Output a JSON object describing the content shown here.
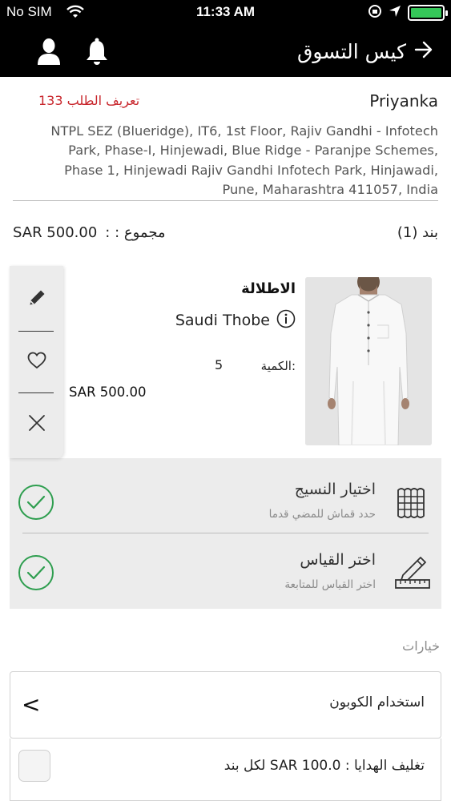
{
  "status_bar": {
    "carrier": "No SIM",
    "time": "11:33 AM",
    "battery_level": 1.0
  },
  "nav": {
    "title": "كيس التسوق",
    "back_icon": "arrow-right-icon",
    "user_icon": "user-icon",
    "bell_icon": "bell-icon"
  },
  "order": {
    "label": "تعريف الطلب 133",
    "customer_name": "Priyanka",
    "address_lines": [
      "NTPL SEZ (Blueridge), IT6, 1st Floor, Rajiv Gandhi - Infotech",
      "Park, Phase-I, Hinjewadi, Blue Ridge - Paranjpe Schemes,",
      "Phase 1, Hinjewadi Rajiv Gandhi Infotech Park, Hinjawadi,",
      "Pune, Maharashtra 411057, India"
    ]
  },
  "summary": {
    "total_label": "مجموع : :",
    "total_value": "SAR 500.00",
    "items_count": "بند (1)"
  },
  "product": {
    "title": "الاطلالة",
    "name": "Saudi Thobe",
    "qty_label": "الكمية:",
    "qty_value": "5",
    "price": "SAR 500.00",
    "actions": [
      "edit-icon",
      "heart-icon",
      "close-icon"
    ]
  },
  "options_rows": [
    {
      "title": "اختيار النسيج",
      "subtitle": "حدد قماش للمضي قدما",
      "icon": "fabric-icon",
      "status": "check-icon"
    },
    {
      "title": "اختر القياس",
      "subtitle": "اختر القياس للمتابعة",
      "icon": "measure-icon",
      "status": "check-icon"
    }
  ],
  "options": {
    "heading": "خيارات",
    "coupon_label": "استخدام الكوبون",
    "coupon_chevron": "<",
    "gift_wrap_label": "تغليف الهدايا : SAR 100.0 لكل بند"
  },
  "colors": {
    "accent_red": "#c8262c",
    "check_green": "#2e9e4f",
    "nav_bg": "#000000"
  }
}
